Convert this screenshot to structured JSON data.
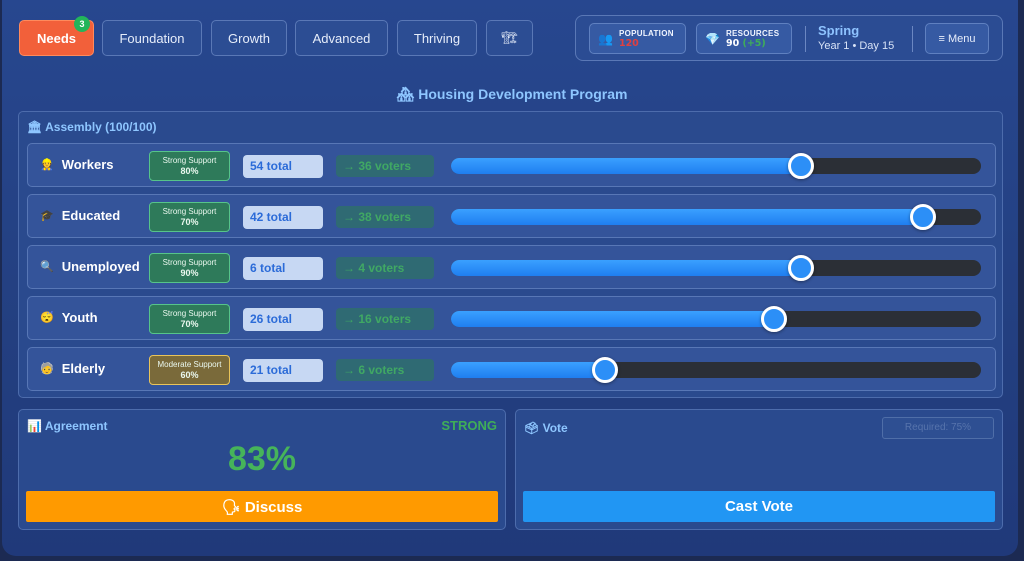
{
  "tabs": [
    {
      "label": "Needs",
      "badge": "3",
      "active": true
    },
    {
      "label": "Foundation"
    },
    {
      "label": "Growth"
    },
    {
      "label": "Advanced"
    },
    {
      "label": "Thriving"
    },
    {
      "label": "🏗"
    }
  ],
  "status": {
    "population": {
      "label": "POPULATION",
      "value": "120",
      "icon": "people-icon",
      "color": "#e04040"
    },
    "resources": {
      "label": "RESOURCES",
      "value": "90",
      "delta": "(+5)",
      "icon": "gem-icon",
      "delta_color": "#3fae58"
    },
    "season": "Spring",
    "date": "Year 1 • Day 15",
    "menu_label": "≡  Menu"
  },
  "program": {
    "icon": "🏘",
    "title": "Housing Development Program"
  },
  "assembly": {
    "icon": "🏛",
    "title": "Assembly (100/100)",
    "rows": [
      {
        "icon": "👷",
        "name": "Workers",
        "support_label": "Strong Support",
        "support_pct": "80%",
        "total": "54 total",
        "voters": "→ 36 voters",
        "level": 0.66
      },
      {
        "icon": "🎓",
        "name": "Educated",
        "support_label": "Strong Support",
        "support_pct": "70%",
        "total": "42 total",
        "voters": "→ 38 voters",
        "level": 0.89
      },
      {
        "icon": "🔍",
        "name": "Unemployed",
        "support_label": "Strong Support",
        "support_pct": "90%",
        "total": "6 total",
        "voters": "→ 4 voters",
        "level": 0.66
      },
      {
        "icon": "😴",
        "name": "Youth",
        "support_label": "Strong Support",
        "support_pct": "70%",
        "total": "26 total",
        "voters": "→ 16 voters",
        "level": 0.61
      },
      {
        "icon": "🧓",
        "name": "Elderly",
        "support_label": "Moderate Support",
        "support_pct": "60%",
        "total": "21 total",
        "voters": "→ 6 voters",
        "level": 0.29
      }
    ]
  },
  "agreement": {
    "icon": "📊",
    "title": "Agreement",
    "strength": "STRONG",
    "percent": "83%",
    "button": "🗣 Discuss"
  },
  "vote": {
    "icon": "🗳",
    "title": "Vote",
    "ghost_label": "Required: 75%",
    "button": "Cast Vote"
  },
  "colors": {
    "accent_tab": "#f2603a",
    "discuss": "#ff9a00",
    "cast_vote": "#2196f3",
    "agreement": "#46b45a"
  }
}
